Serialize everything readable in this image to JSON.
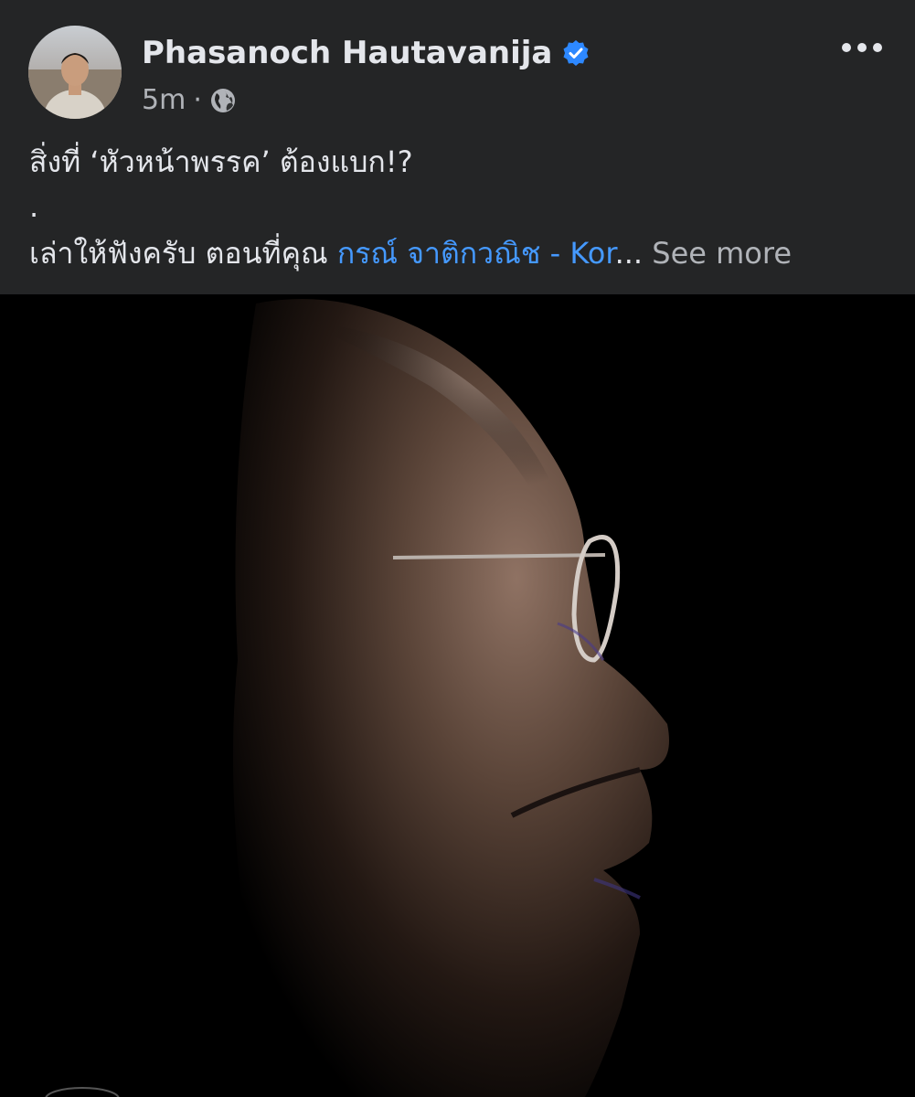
{
  "post": {
    "author": {
      "name": "Phasanoch Hautavanija",
      "verified_icon": "verified-badge-icon",
      "avatar_icon": "profile-photo"
    },
    "meta": {
      "time": "5m",
      "separator": "·",
      "audience_icon": "globe-icon"
    },
    "more_icon": "more-options-icon",
    "text": {
      "line1": "สิ่งที่ ‘หัวหน้าพรรค’ ต้องแบก!?",
      "line2": ".",
      "line3_prefix": "เล่าให้ฟังครับ ตอนที่คุณ ",
      "line3_mention": "กรณ์ จาติกวณิช - Kor",
      "line3_ellipsis": "...",
      "see_more": " See more"
    },
    "image_icon": "portrait-photo"
  },
  "colors": {
    "header_bg": "#242526",
    "text": "#e4e6eb",
    "secondary_text": "#b0b3b8",
    "link": "#4599ff",
    "verified": "#2d88ff",
    "image_bg": "#000000"
  }
}
